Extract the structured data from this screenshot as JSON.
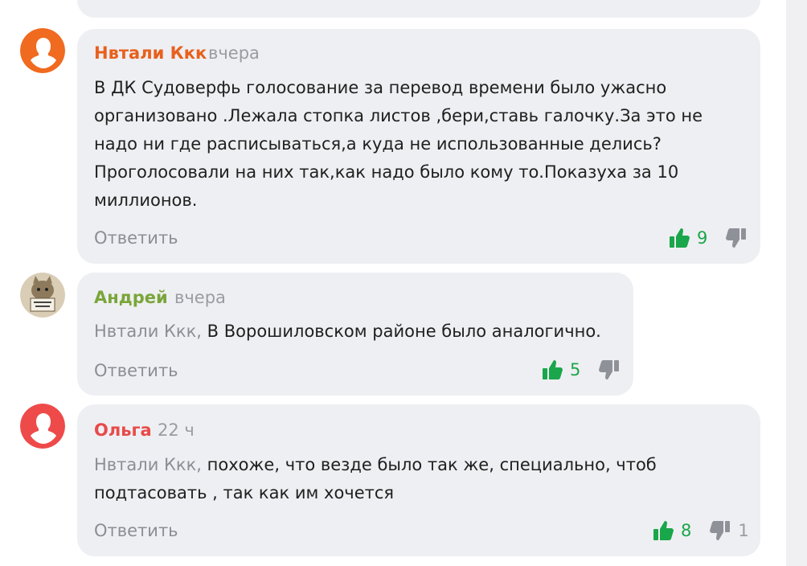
{
  "comments": [
    {
      "author": "Нвтали Ккк",
      "author_color": "#e8601c",
      "avatar_bg": "#f06a1f",
      "time": "вчера",
      "mention": "",
      "text": "В ДК Судоверфь голосование за перевод времени было ужасно организовано .Лежала стопка листов ,бери,ставь галочку.За это не надо ни где расписываться,а куда не использованные делись? Проголосовали на них так,как надо было кому то.Показуха за 10 миллионов.",
      "reply_label": "Ответить",
      "likes": "9",
      "dislikes": ""
    },
    {
      "author": "Андрей",
      "author_color": "#7aa53a",
      "avatar_bg": "#c9b79a",
      "time": "вчера",
      "mention": "Нвтали Ккк,",
      "text": "В Ворошиловском районе было аналогично.",
      "reply_label": "Ответить",
      "likes": "5",
      "dislikes": ""
    },
    {
      "author": "Ольга",
      "author_color": "#e84a4a",
      "avatar_bg": "#ee4a4a",
      "time": "22 ч",
      "mention": "Нвтали Ккк,",
      "text": "похоже, что везде было так же, специально, чтоб подтасовать , так как им хочется",
      "reply_label": "Ответить",
      "likes": "8",
      "dislikes": "1"
    }
  ]
}
